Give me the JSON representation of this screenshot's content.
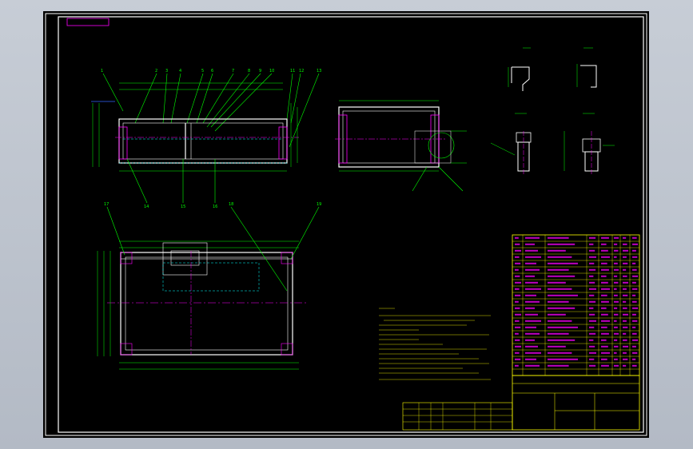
{
  "stamp_label": "",
  "notes_title": "",
  "notes_lines": [
    "",
    "",
    "",
    "",
    "",
    "",
    "",
    "",
    "",
    ""
  ],
  "title_block": {
    "drawing_title": "",
    "drawing_number": "",
    "part_name": "",
    "scale": ""
  },
  "colors": {
    "background": "#000000",
    "frame": "#ffffff",
    "outline": "#ffffff",
    "dimension": "#00ff00",
    "centerline": "#ff00ff",
    "hidden": "#00ffff",
    "leader": "#00ff00",
    "table_text": "#ff00ff",
    "table_line": "#ffff00",
    "note_text": "#ffff00",
    "stamp": "#ff00ff"
  }
}
